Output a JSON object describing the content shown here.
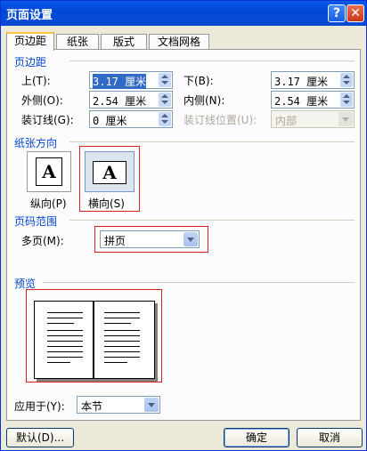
{
  "window": {
    "title": "页面设置",
    "help_glyph": "?",
    "close_glyph": "✕"
  },
  "tabs": [
    "页边距",
    "纸张",
    "版式",
    "文档网格"
  ],
  "margins": {
    "section": "页边距",
    "top_label": "上(T):",
    "top_value": "3.17 厘米",
    "bottom_label": "下(B):",
    "bottom_value": "3.17 厘米",
    "outer_label": "外侧(O):",
    "outer_value": "2.54 厘米",
    "inner_label": "内侧(N):",
    "inner_value": "2.54 厘米",
    "gutter_label": "装订线(G):",
    "gutter_value": "0 厘米",
    "gutter_pos_label": "装订线位置(U):",
    "gutter_pos_value": "内部"
  },
  "orientation": {
    "section": "纸张方向",
    "portrait_label": "纵向(P)",
    "landscape_label": "横向(S)",
    "glyph": "A"
  },
  "pages": {
    "section": "页码范围",
    "multi_label": "多页(M):",
    "multi_value": "拼页"
  },
  "preview": {
    "section": "预览"
  },
  "apply": {
    "label": "应用于(Y):",
    "value": "本节"
  },
  "buttons": {
    "default": "默认(D)...",
    "ok": "确定",
    "cancel": "取消"
  }
}
